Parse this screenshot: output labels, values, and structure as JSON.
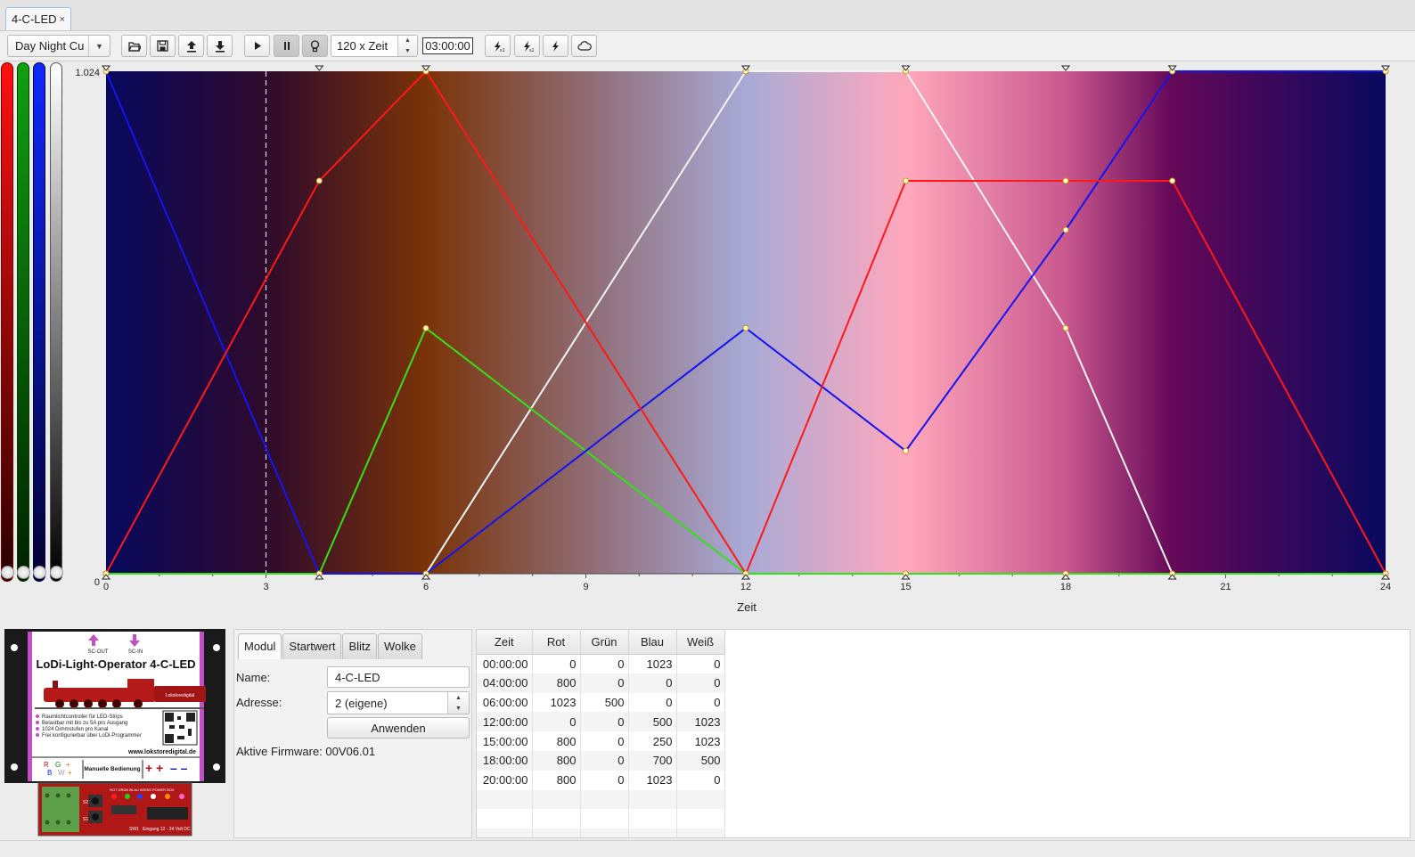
{
  "window": {
    "tab_title": "4-C-LED",
    "tab_close": "×"
  },
  "toolbar": {
    "preset": "Day Night Cu",
    "speed": "120 x Zeit",
    "time": "03:00:00",
    "buttons": [
      "folder-open-icon",
      "save-icon",
      "upload-icon",
      "download-icon",
      "play-icon",
      "pause-icon",
      "bulb-icon",
      "lightning-icon",
      "lightning-icon",
      "lightning-icon",
      "cloud-icon"
    ]
  },
  "sliders": [
    {
      "name": "red",
      "color": "#e01010"
    },
    {
      "name": "green",
      "color": "#109010"
    },
    {
      "name": "blue",
      "color": "#1020e0"
    },
    {
      "name": "white",
      "color": "#888888"
    }
  ],
  "chart_data": {
    "type": "line",
    "xlabel": "Zeit",
    "x_ticks": [
      0,
      3,
      6,
      9,
      12,
      15,
      18,
      21,
      24
    ],
    "y_ticks": [
      0,
      1.024
    ],
    "y_tick_labels": [
      "0",
      "1.024"
    ],
    "xlim": [
      0,
      24
    ],
    "ylim": [
      0,
      1023
    ],
    "current_time": 3,
    "background_stops": [
      {
        "t": 0,
        "color": "#08095e"
      },
      {
        "t": 3,
        "color": "#2e0a2c"
      },
      {
        "t": 6,
        "color": "#7a3308"
      },
      {
        "t": 9,
        "color": "#8f6b72"
      },
      {
        "t": 12,
        "color": "#a8aad6"
      },
      {
        "t": 15,
        "color": "#ffa8bc"
      },
      {
        "t": 18,
        "color": "#c9588e"
      },
      {
        "t": 20,
        "color": "#650858"
      },
      {
        "t": 24,
        "color": "#08095e"
      }
    ],
    "series": [
      {
        "name": "Rot",
        "color": "#ff1818",
        "x": [
          0,
          4,
          6,
          12,
          15,
          18,
          20,
          24
        ],
        "y": [
          0,
          800,
          1023,
          0,
          800,
          800,
          800,
          0
        ]
      },
      {
        "name": "Grün",
        "color": "#33e01a",
        "x": [
          0,
          4,
          6,
          12,
          15,
          18,
          20,
          24
        ],
        "y": [
          0,
          0,
          500,
          0,
          0,
          0,
          0,
          0
        ]
      },
      {
        "name": "Blau",
        "color": "#1414f0",
        "x": [
          0,
          4,
          6,
          12,
          15,
          18,
          20,
          24
        ],
        "y": [
          1023,
          0,
          0,
          500,
          250,
          700,
          1023,
          1023
        ]
      },
      {
        "name": "Weiß",
        "color": "#f4f4f4",
        "x": [
          0,
          4,
          6,
          12,
          15,
          18,
          20,
          24
        ],
        "y": [
          0,
          0,
          0,
          1023,
          1023,
          500,
          0,
          0
        ]
      }
    ],
    "marker_x": [
      0,
      4,
      6,
      12,
      15,
      18,
      20,
      24
    ]
  },
  "device": {
    "title": "LoDi-Light-Operator  4-C-LED",
    "sc_out": "SC-OUT",
    "sc_in": "SC-IN",
    "features": [
      "Raumlichtcontroller für LED-Strips",
      "Belastbar mit bis zu 5A pro Ausgang",
      "1024 Dimmstufen pro Kanal",
      "Frei konfigurierbar über LoDi-Programmer"
    ],
    "url": "www.lokstoredigital.de",
    "manual": "Manuelle Bedienung",
    "letters": [
      "R",
      "G",
      "+",
      "B",
      "W",
      "+"
    ],
    "brand": "Lokstoredigital",
    "board_labels": "ROT GRÜN BLAU WEISS POWER BOX",
    "board_input": "Eingang 12 - 24 Volt DC",
    "board_sw": "SW1",
    "board_s1": "S1",
    "board_s2": "S2"
  },
  "module_panel": {
    "tabs": [
      "Modul",
      "Startwert",
      "Blitz",
      "Wolke"
    ],
    "name_label": "Name:",
    "name_value": "4-C-LED",
    "address_label": "Adresse:",
    "address_value": "2 (eigene)",
    "apply_label": "Anwenden",
    "firmware": "Aktive Firmware: 00V06.01"
  },
  "table": {
    "columns": [
      "Zeit",
      "Rot",
      "Grün",
      "Blau",
      "Weiß"
    ],
    "rows": [
      [
        "00:00:00",
        "0",
        "0",
        "1023",
        "0"
      ],
      [
        "04:00:00",
        "800",
        "0",
        "0",
        "0"
      ],
      [
        "06:00:00",
        "1023",
        "500",
        "0",
        "0"
      ],
      [
        "12:00:00",
        "0",
        "0",
        "500",
        "1023"
      ],
      [
        "15:00:00",
        "800",
        "0",
        "250",
        "1023"
      ],
      [
        "18:00:00",
        "800",
        "0",
        "700",
        "500"
      ],
      [
        "20:00:00",
        "800",
        "0",
        "1023",
        "0"
      ]
    ]
  }
}
